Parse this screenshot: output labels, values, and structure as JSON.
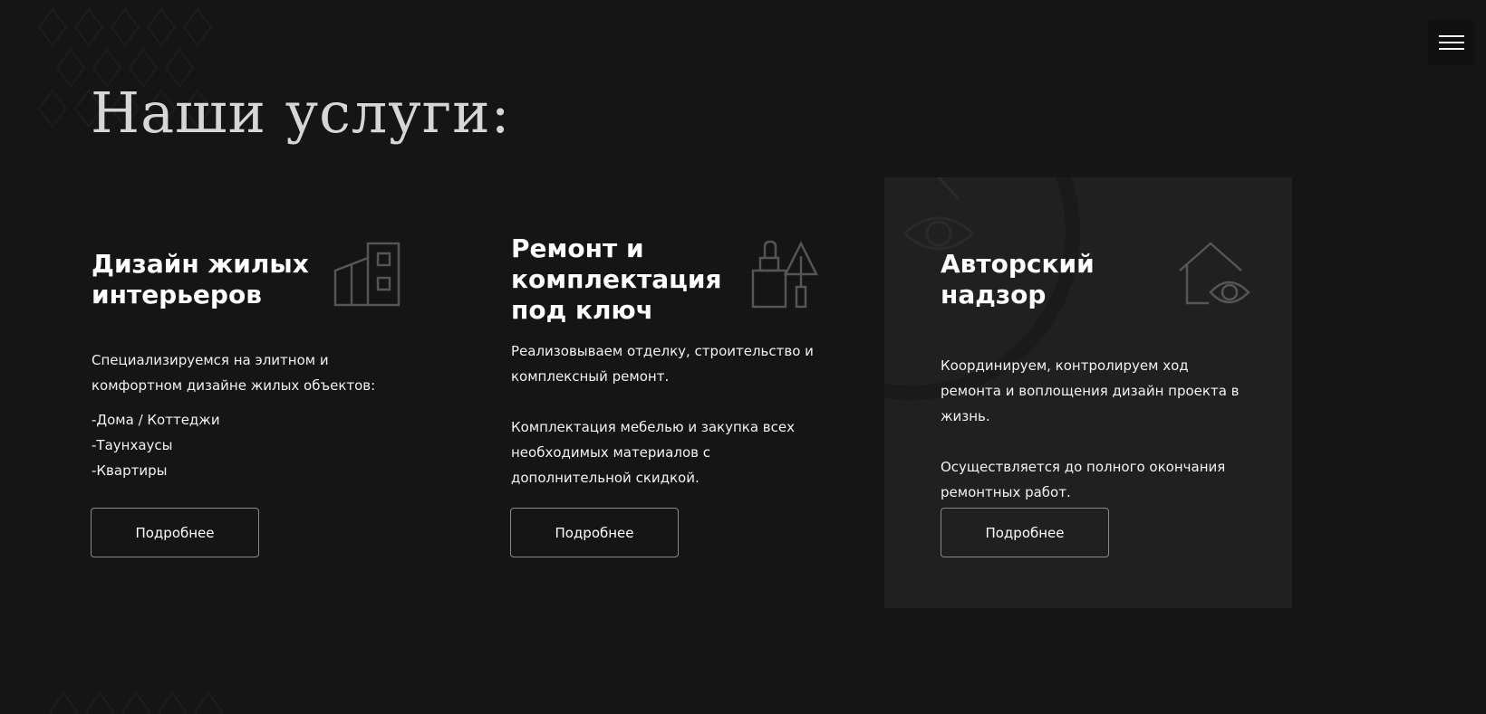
{
  "header": {
    "menu_icon": "hamburger-menu-icon"
  },
  "section": {
    "title": "Наши услуги:"
  },
  "services": [
    {
      "title": "Дизайн жилых\nинтерьеров",
      "icon": "building-icon",
      "intro": "Специализируемся на элитном и комфортном дизайне жилых объектов:",
      "list": [
        "-Дома / Коттеджи",
        "-Таунхаусы",
        "-Квартиры"
      ],
      "button": "Подробнее"
    },
    {
      "title": "Ремонт и\nкомплектация\nпод ключ",
      "icon": "paint-tools-icon",
      "paragraphs": [
        "Реализовываем отделку, строительство и комплексный ремонт.",
        "Комплектация мебелью и закупка всех необходимых материалов с дополнительной скидкой."
      ],
      "button": "Подробнее"
    },
    {
      "title": "Авторский\nнадзор",
      "icon": "house-eye-icon",
      "paragraphs": [
        "Координируем, контролируем ход ремонта и воплощения дизайн проекта в жизнь.",
        "Осуществляется до полного окончания ремонтных работ."
      ],
      "button": "Подробнее"
    }
  ],
  "colors": {
    "background": "#151515",
    "card_highlight": "#202020",
    "title": "#d6d6d6",
    "text": "#ffffff",
    "icon_stroke": "#555555",
    "button_border": "#8a8a8a"
  }
}
